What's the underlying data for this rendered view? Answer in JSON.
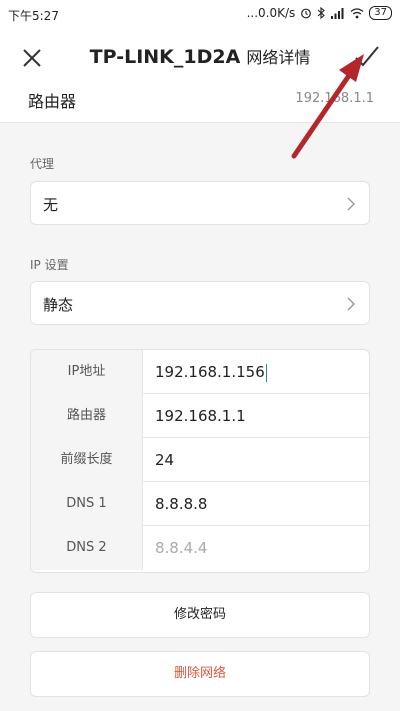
{
  "status_bar": {
    "time": "下午5:27",
    "network_speed": "...0.0K/s",
    "battery": "37"
  },
  "header": {
    "network_name": "TP-LINK_1D2A",
    "subtitle": "网络详情"
  },
  "router_row": {
    "label": "路由器",
    "value": "192.168.1.1"
  },
  "proxy": {
    "section_label": "代理",
    "value": "无"
  },
  "ip_settings": {
    "section_label": "IP 设置",
    "value": "静态"
  },
  "ip_fields": {
    "ip_address": {
      "label": "IP地址",
      "value": "192.168.1.156"
    },
    "router": {
      "label": "路由器",
      "value": "192.168.1.1"
    },
    "prefix_length": {
      "label": "前缀长度",
      "value": "24"
    },
    "dns1": {
      "label": "DNS 1",
      "value": "8.8.8.8"
    },
    "dns2": {
      "label": "DNS 2",
      "placeholder": "8.8.4.4"
    }
  },
  "buttons": {
    "modify_password": "修改密码",
    "delete_network": "删除网络"
  },
  "colors": {
    "accent_caret": "#2a7ae2",
    "danger": "#e0573e",
    "annotation_arrow": "#b3262a"
  }
}
